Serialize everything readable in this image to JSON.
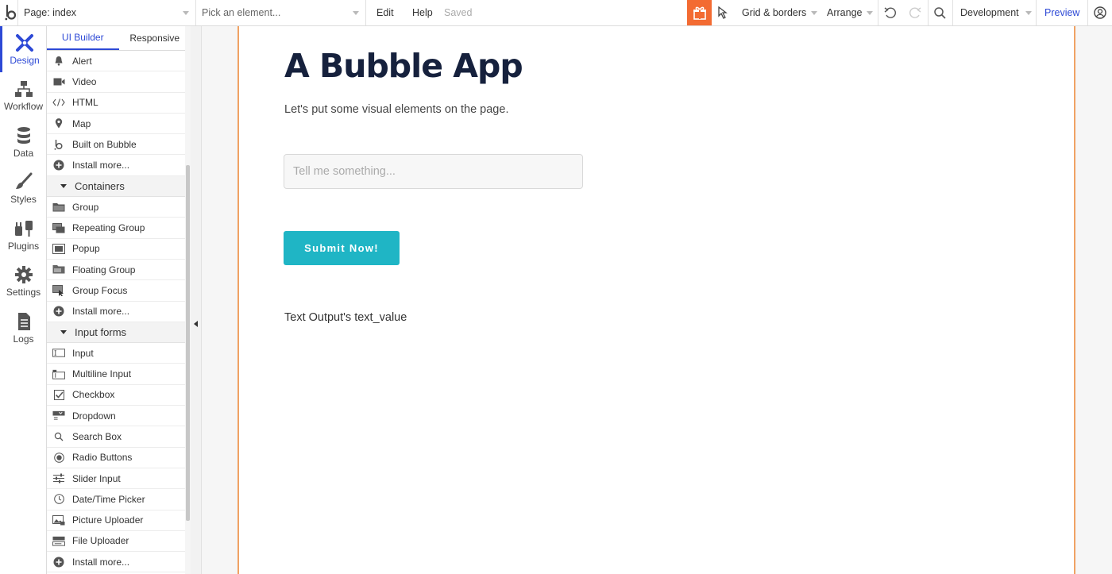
{
  "topbar": {
    "page_selector": "Page: index",
    "element_picker_placeholder": "Pick an element...",
    "edit": "Edit",
    "help": "Help",
    "saved": "Saved",
    "grid_borders": "Grid & borders",
    "arrange": "Arrange",
    "environment": "Development",
    "preview": "Preview"
  },
  "rail": {
    "items": [
      {
        "label": "Design",
        "icon": "design-icon"
      },
      {
        "label": "Workflow",
        "icon": "workflow-icon"
      },
      {
        "label": "Data",
        "icon": "database-icon"
      },
      {
        "label": "Styles",
        "icon": "brush-icon"
      },
      {
        "label": "Plugins",
        "icon": "plug-icon"
      },
      {
        "label": "Settings",
        "icon": "gear-icon"
      },
      {
        "label": "Logs",
        "icon": "document-icon"
      }
    ]
  },
  "palette": {
    "tabs": [
      "UI Builder",
      "Responsive"
    ],
    "items": [
      {
        "label": "Alert",
        "icon": "bell-icon"
      },
      {
        "label": "Video",
        "icon": "video-icon"
      },
      {
        "label": "HTML",
        "icon": "code-icon"
      },
      {
        "label": "Map",
        "icon": "map-pin-icon"
      },
      {
        "label": "Built on Bubble",
        "icon": "bubble-logo-icon"
      },
      {
        "label": "Install more...",
        "icon": "plus-circle-icon"
      },
      {
        "label": "Containers",
        "header": true
      },
      {
        "label": "Group",
        "icon": "folder-icon"
      },
      {
        "label": "Repeating Group",
        "icon": "repeating-group-icon"
      },
      {
        "label": "Popup",
        "icon": "popup-icon"
      },
      {
        "label": "Floating Group",
        "icon": "floating-group-icon"
      },
      {
        "label": "Group Focus",
        "icon": "group-focus-icon"
      },
      {
        "label": "Install more...",
        "icon": "plus-circle-icon"
      },
      {
        "label": "Input forms",
        "header": true
      },
      {
        "label": "Input",
        "icon": "input-icon"
      },
      {
        "label": "Multiline Input",
        "icon": "multiline-input-icon"
      },
      {
        "label": "Checkbox",
        "icon": "checkbox-icon"
      },
      {
        "label": "Dropdown",
        "icon": "dropdown-icon"
      },
      {
        "label": "Search Box",
        "icon": "search-icon"
      },
      {
        "label": "Radio Buttons",
        "icon": "radio-icon"
      },
      {
        "label": "Slider Input",
        "icon": "slider-icon"
      },
      {
        "label": "Date/Time Picker",
        "icon": "clock-icon"
      },
      {
        "label": "Picture Uploader",
        "icon": "picture-icon"
      },
      {
        "label": "File Uploader",
        "icon": "file-uploader-icon"
      },
      {
        "label": "Install more...",
        "icon": "plus-circle-icon"
      }
    ]
  },
  "canvas": {
    "title": "A Bubble App",
    "subtitle": "Let's put some visual elements on the page.",
    "input_placeholder": "Tell me something...",
    "button_label": "Submit Now!",
    "text_output": "Text Output's text_value"
  },
  "colors": {
    "accent_blue": "#2d49d6",
    "gift_orange": "#f36b32",
    "page_border_orange": "#f0a264",
    "button_teal": "#1fb5c5",
    "title_navy": "#16213d"
  }
}
